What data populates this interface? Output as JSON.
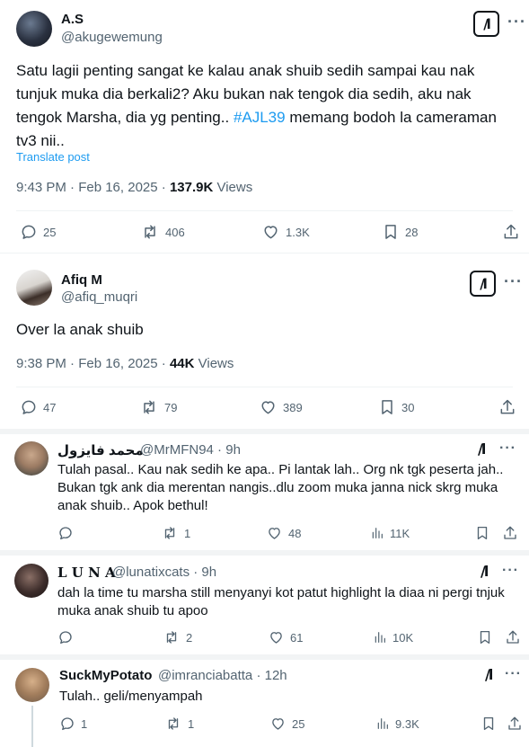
{
  "tweet1": {
    "name": "A.S",
    "handle": "@akugewemung",
    "text_line1": "Satu lagii penting sangat ke kalau anak shuib sedih sampai kau nak",
    "text_line2": "tunjuk muka dia berkali2? Aku bukan nak tengok dia sedih, aku nak",
    "text_line3_pre": "tengok Marsha, dia yg penting.. ",
    "hashtag": "#AJL39",
    "text_line3_post": "  memang bodoh la cameraman",
    "text_line4": "tv3 nii..",
    "translate": "Translate post",
    "time": "9:43 PM · Feb 16, 2025 · ",
    "views_count": "137.9K",
    "views_label": " Views",
    "replies": "25",
    "reposts": "406",
    "likes": "1.3K",
    "bookmarks": "28"
  },
  "tweet2": {
    "name": "Afiq M",
    "handle": "@afiq_muqri",
    "text": "Over la anak shuib",
    "time": "9:38 PM · Feb 16, 2025 · ",
    "views_count": "44K",
    "views_label": " Views",
    "replies": "47",
    "reposts": "79",
    "likes": "389",
    "bookmarks": "30"
  },
  "reply1": {
    "name": "محمد فايزول",
    "handle": "@MrMFN94 · 9h",
    "line1": "Tulah pasal.. Kau nak sedih ke apa.. Pi lantak lah.. Org nk tgk peserta jah..",
    "line2": "Bukan tgk ank dia merentan nangis..dlu zoom muka janna nick skrg muka",
    "line3": "anak shuib.. Apok bethul!",
    "replies": "",
    "reposts": "1",
    "likes": "48",
    "views": "11K"
  },
  "reply2": {
    "name": "𝐋 𝐔 𝐍 𝐀",
    "handle": "@lunatixcats · 9h",
    "line1": "dah la time tu marsha still menyanyi kot patut highlight la diaa ni pergi tnjuk",
    "line2": "muka anak shuib tu apoo",
    "replies": "",
    "reposts": "2",
    "likes": "61",
    "views": "10K"
  },
  "reply3": {
    "name": "SuckMyPotato",
    "handle": "@imranciabatta · 12h",
    "line1": "Tulah.. geli/menyampah",
    "replies": "1",
    "reposts": "1",
    "likes": "25",
    "views": "9.3K"
  },
  "icons": {
    "grok": "grok-icon",
    "more": "more-icon",
    "reply": "reply-icon",
    "repost": "repost-icon",
    "like": "like-icon",
    "bookmark": "bookmark-icon",
    "share": "share-icon",
    "views": "views-icon"
  },
  "ui": {
    "grok_glyph": "/l",
    "more_glyph": "···"
  },
  "colors": {
    "link": "#1d9bf0",
    "text": "#0f1419",
    "muted": "#536471"
  }
}
